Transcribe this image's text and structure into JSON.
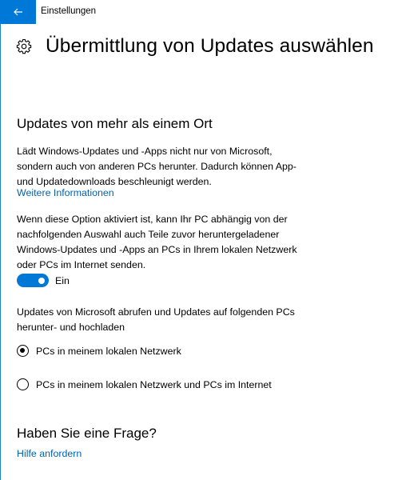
{
  "window": {
    "title": "Einstellungen",
    "accent_color": "#0078d7",
    "back_icon": "back-arrow-icon"
  },
  "header": {
    "icon": "gear-icon",
    "title": "Übermittlung von Updates auswählen"
  },
  "section": {
    "heading": "Updates von mehr als einem Ort",
    "description_lines": [
      "Lädt Windows-Updates und -Apps nicht nur von Microsoft,",
      "sondern auch von anderen PCs herunter. Dadurch können App-",
      "und Updatedownloads beschleunigt werden."
    ],
    "more_info_link": "Weitere Informationen",
    "option_description_lines": [
      "Wenn diese Option aktiviert ist, kann Ihr PC abhängig von der",
      "nachfolgenden Auswahl auch Teile zuvor heruntergeladener",
      "Windows-Updates und -Apps an PCs in Ihrem lokalen Netzwerk",
      "oder PCs im Internet senden."
    ],
    "toggle": {
      "state": "on",
      "label": "Ein"
    },
    "radio_intro_lines": [
      "Updates von Microsoft abrufen und Updates auf folgenden PCs",
      "herunter- und hochladen"
    ],
    "radio_options": [
      {
        "label": "PCs in meinem lokalen Netzwerk",
        "selected": true
      },
      {
        "label": "PCs in meinem lokalen Netzwerk und PCs im Internet",
        "selected": false
      }
    ]
  },
  "help": {
    "heading": "Haben Sie eine Frage?",
    "link": "Hilfe anfordern"
  }
}
